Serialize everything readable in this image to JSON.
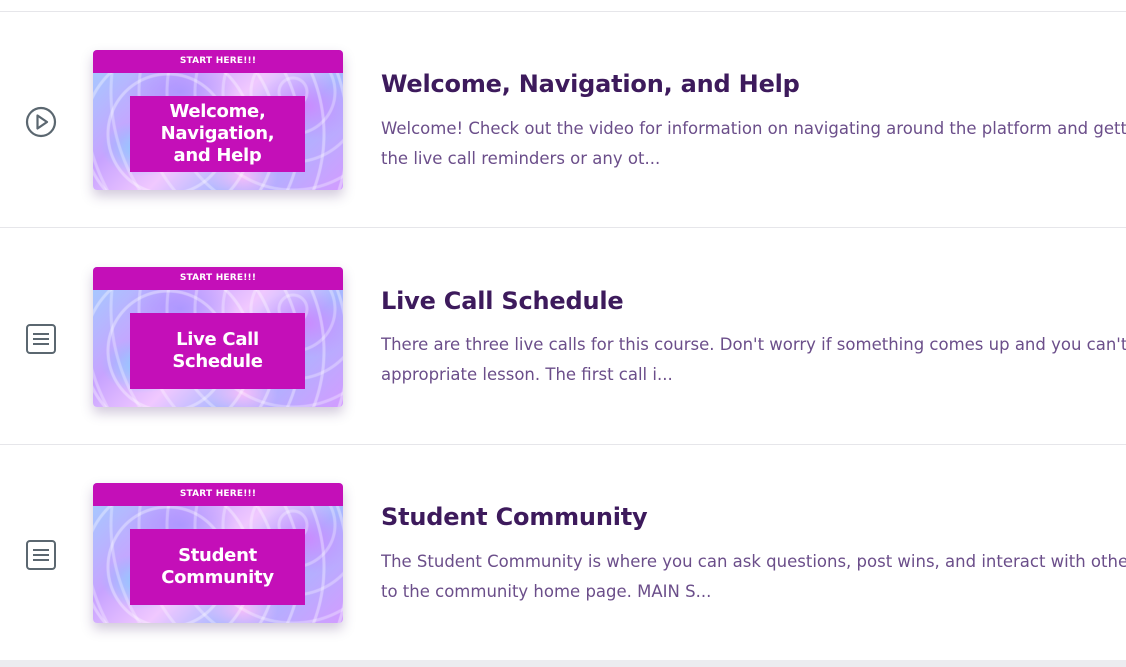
{
  "lessons": [
    {
      "type_icon": "play-circle-icon",
      "thumbnail": {
        "banner": "START HERE!!!",
        "title": "Welcome,\nNavigation,\nand Help"
      },
      "title": "Welcome, Navigation, and Help",
      "description_line1": " Welcome! Check out the video for information on navigating around the platform and getti",
      "description_line2": "the live call reminders or any ot..."
    },
    {
      "type_icon": "text-document-icon",
      "thumbnail": {
        "banner": "START HERE!!!",
        "title": "Live Call\nSchedule"
      },
      "title": "Live Call Schedule",
      "description_line1": "There are three live calls for this course. Don't worry if something comes up and you can't at",
      "description_line2": "appropriate lesson. The first call i..."
    },
    {
      "type_icon": "text-document-icon",
      "thumbnail": {
        "banner": "START HERE!!!",
        "title": "Student\nCommunity"
      },
      "title": "Student Community",
      "description_line1": "The Student Community is where you can ask questions, post wins, and interact with other p",
      "description_line2": "to the community home page. MAIN S..."
    }
  ],
  "colors": {
    "title": "#3d1a5c",
    "description": "#6b4e8a",
    "thumbnail_accent": "#c40fb8",
    "icon": "#5b6770"
  }
}
